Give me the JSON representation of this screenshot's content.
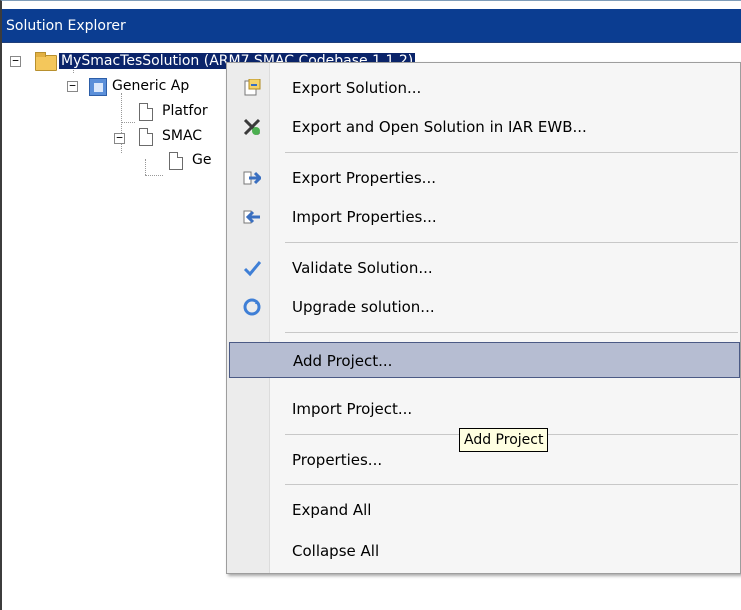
{
  "panel": {
    "title": "Solution Explorer"
  },
  "tree": {
    "root_label": "MySmacTesSolution (ARM7 SMAC Codebase 1.1.2)",
    "child1_label": "Generic Ap",
    "child2_label": "Platfor",
    "child3_label": "SMAC",
    "child4_label": "Ge",
    "expander_minus": "−"
  },
  "context_menu": {
    "items": [
      {
        "label": "Export Solution...",
        "icon": "export-solution-icon"
      },
      {
        "label": "Export and Open Solution in IAR EWB...",
        "icon": "export-open-iar-icon"
      },
      {
        "label": "Export Properties...",
        "icon": "export-properties-icon"
      },
      {
        "label": "Import Properties...",
        "icon": "import-properties-icon"
      },
      {
        "label": "Validate Solution...",
        "icon": "checkmark-icon"
      },
      {
        "label": "Upgrade solution...",
        "icon": "refresh-icon"
      },
      {
        "label": "Add Project...",
        "icon": ""
      },
      {
        "label": "Import Project...",
        "icon": ""
      },
      {
        "label": "Properties...",
        "icon": ""
      },
      {
        "label": "Expand All",
        "icon": ""
      },
      {
        "label": "Collapse All",
        "icon": ""
      }
    ],
    "hovered_index": 6
  },
  "tooltip": {
    "text": "Add Project"
  },
  "colors": {
    "title_bg": "#0b3d91",
    "selection_bg": "#0a246a",
    "menu_hover_bg": "#b6bdd2",
    "tooltip_bg": "#ffffe1"
  }
}
